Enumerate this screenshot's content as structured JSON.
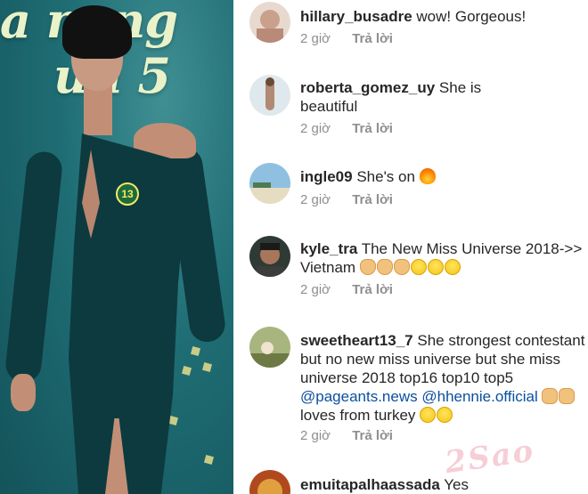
{
  "photo": {
    "background_text_line1": "a nang",
    "background_text_line2": "ưu 5",
    "badge_number": "13"
  },
  "comments": [
    {
      "username": "hillary_busadre",
      "text": " wow! Gorgeous!",
      "time": "2 giờ",
      "reply_label": "Trả lời",
      "avatar_color": "#c9a08c"
    },
    {
      "username": "roberta_gomez_uy",
      "text": " She is beautiful",
      "time": "2 giờ",
      "reply_label": "Trả lời",
      "avatar_color": "#9fb8c4"
    },
    {
      "username": "ingle09",
      "text": " She's on",
      "emojis": [
        "fire"
      ],
      "time": "2 giờ",
      "reply_label": "Trả lời",
      "avatar_color": "#6ea3c8"
    },
    {
      "username": "kyle_tra",
      "text": " The New Miss Universe 2018->> Vietnam",
      "emojis": [
        "clap",
        "clap",
        "clap",
        "grin",
        "grin",
        "grin"
      ],
      "time": "2 giờ",
      "reply_label": "Trả lời",
      "avatar_color": "#3a4a3a"
    },
    {
      "username": "sweetheart13_7",
      "text_part1": " She strongest contestant but no new miss universe but she miss universe 2018 top16 top10 top5 ",
      "mention1": "@pageants.news",
      "mention2": "@hhennie.official",
      "text_part2": "loves from turkey",
      "time": "2 giờ",
      "reply_label": "Trả lời",
      "avatar_color": "#7d8f5a"
    },
    {
      "username": "emuitapalhaassada",
      "text": " Yes",
      "avatar_color": "#b04a1e"
    }
  ],
  "watermark": "2Sao"
}
